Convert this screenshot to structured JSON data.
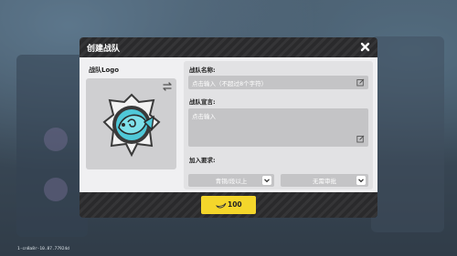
{
  "dialog": {
    "title": "创建战队",
    "close_icon": "close-icon"
  },
  "logo": {
    "label": "战队Logo",
    "swap_icon": "swap-arrows-icon",
    "emblem_icon": "fish-emblem-icon"
  },
  "fields": {
    "name_label": "战队名称:",
    "name_placeholder": "点击输入（不超过8个字符）",
    "declaration_label": "战队宣言:",
    "declaration_placeholder": "点击输入",
    "requirement_label": "加入要求:",
    "requirement_level": "青铜/段以上",
    "requirement_approval": "无需审批"
  },
  "footer": {
    "cost_value": "100",
    "cost_icon": "banana-currency-icon"
  },
  "version": "1-cn8a8r-10.87.77924d"
}
